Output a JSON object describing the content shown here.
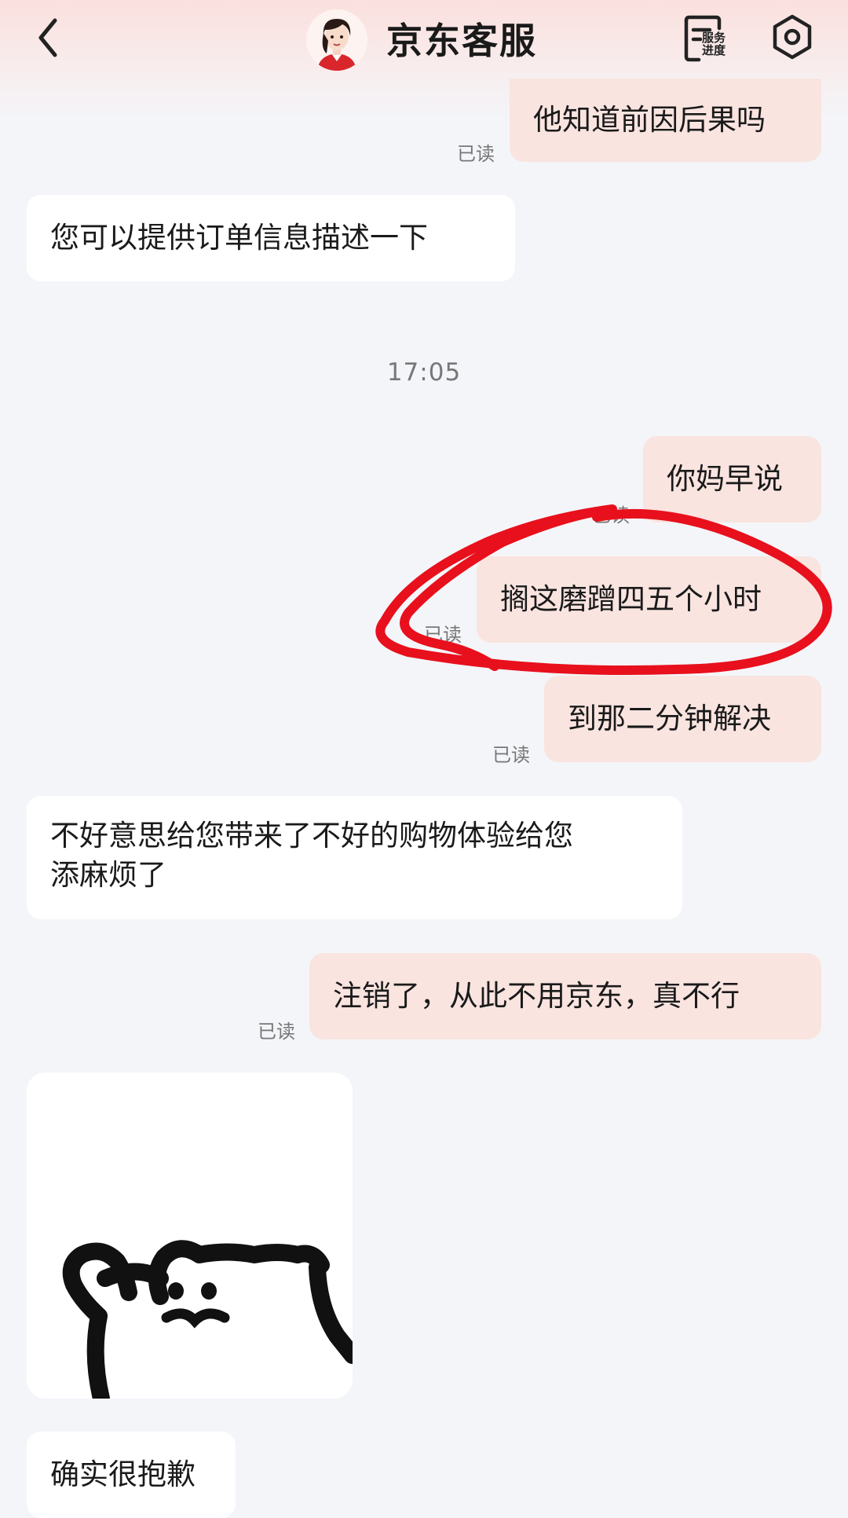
{
  "header": {
    "title": "京东客服",
    "service_label_line1": "服务",
    "service_label_line2": "进度",
    "icons": [
      "back-chevron-icon",
      "agent-avatar",
      "service-progress-icon",
      "settings-icon"
    ]
  },
  "messages": [
    {
      "side": "me",
      "text": "他知道前因后果吗",
      "status": "已读"
    },
    {
      "side": "them",
      "text": "您可以提供订单信息描述一下"
    },
    {
      "timestamp": "17:05"
    },
    {
      "side": "me",
      "text": "你妈早说",
      "status": "已读"
    },
    {
      "side": "me",
      "text": "搁这磨蹭四五个小时",
      "status": "已读"
    },
    {
      "side": "me",
      "text": "到那二分钟解决",
      "status": "已读"
    },
    {
      "side": "them",
      "text_line1": "不好意思给您带来了不好的购物体验给您",
      "text_line2": "添麻烦了"
    },
    {
      "side": "me",
      "text": "注销了，从此不用京东，真不行",
      "status": "已读"
    },
    {
      "side": "them",
      "type": "sticker"
    },
    {
      "side": "them",
      "text": "确实很抱歉"
    }
  ],
  "colors": {
    "my_bubble": "#f9e4e0",
    "their_bubble": "#ffffff",
    "background": "#f4f5f9",
    "annotation_red": "#e8101c"
  }
}
